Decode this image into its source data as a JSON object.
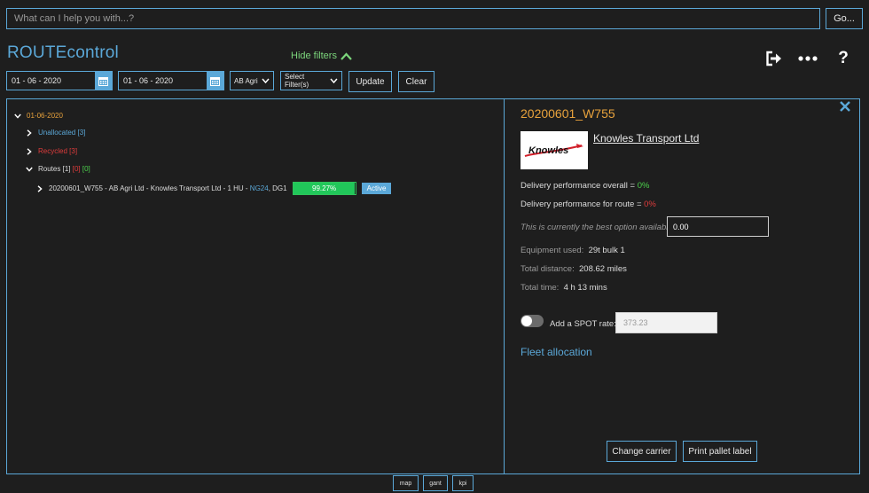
{
  "search": {
    "placeholder": "What can I help you with...?",
    "go_label": "Go..."
  },
  "app": {
    "title": "ROUTEcontrol"
  },
  "filters": {
    "hide_label": "Hide filters",
    "date_from": "01 - 06 - 2020",
    "date_to": "01 - 06 - 2020",
    "company": "AB Agri",
    "filter_select": "Select Filter(s)",
    "update_label": "Update",
    "clear_label": "Clear"
  },
  "header_icons": [
    "logout-icon",
    "more-icon",
    "help-icon"
  ],
  "tree": {
    "date": "01-06-2020",
    "unallocated": {
      "label": "Unallocated",
      "count": "[3]"
    },
    "recycled": {
      "label": "Recycled",
      "count": "[3]"
    },
    "routes": {
      "label": "Routes",
      "c1": "[1]",
      "c2": "[0]",
      "c3": "[0]"
    },
    "route": {
      "text": "20200601_W755 - AB Agri Ltd - Knowles Transport Ltd - 1 HU -",
      "postcode": "NG24",
      "suffix": ", DG1",
      "progress_label": "99.27%",
      "progress_value": 0.9927,
      "status": "Active"
    }
  },
  "detail": {
    "route_id": "20200601_W755",
    "logo_text": "Knowles",
    "carrier": "Knowles Transport Ltd",
    "perf_overall_label": "Delivery performance overall =",
    "perf_overall_value": "0%",
    "perf_route_label": "Delivery performance for route =",
    "perf_route_value": "0%",
    "best_option_text": "This is currently the best option available",
    "best_option_value": "0.00",
    "equipment_label": "Equipment used:",
    "equipment_value": "29t bulk 1",
    "distance_label": "Total distance:",
    "distance_value": "208.62 miles",
    "time_label": "Total time:",
    "time_value": "4 h 13 mins",
    "spot_label": "Add a SPOT rate:",
    "spot_placeholder": "373.23",
    "fleet_label": "Fleet allocation",
    "change_carrier_label": "Change carrier",
    "print_label": "Print pallet label"
  },
  "bottom_tabs": [
    "map",
    "gant",
    "kpi"
  ],
  "colors": {
    "accent": "#5ba8d8",
    "orange": "#e8a23c",
    "green": "#4cd14c",
    "red": "#e03c3c",
    "background": "#1e1e1e"
  }
}
